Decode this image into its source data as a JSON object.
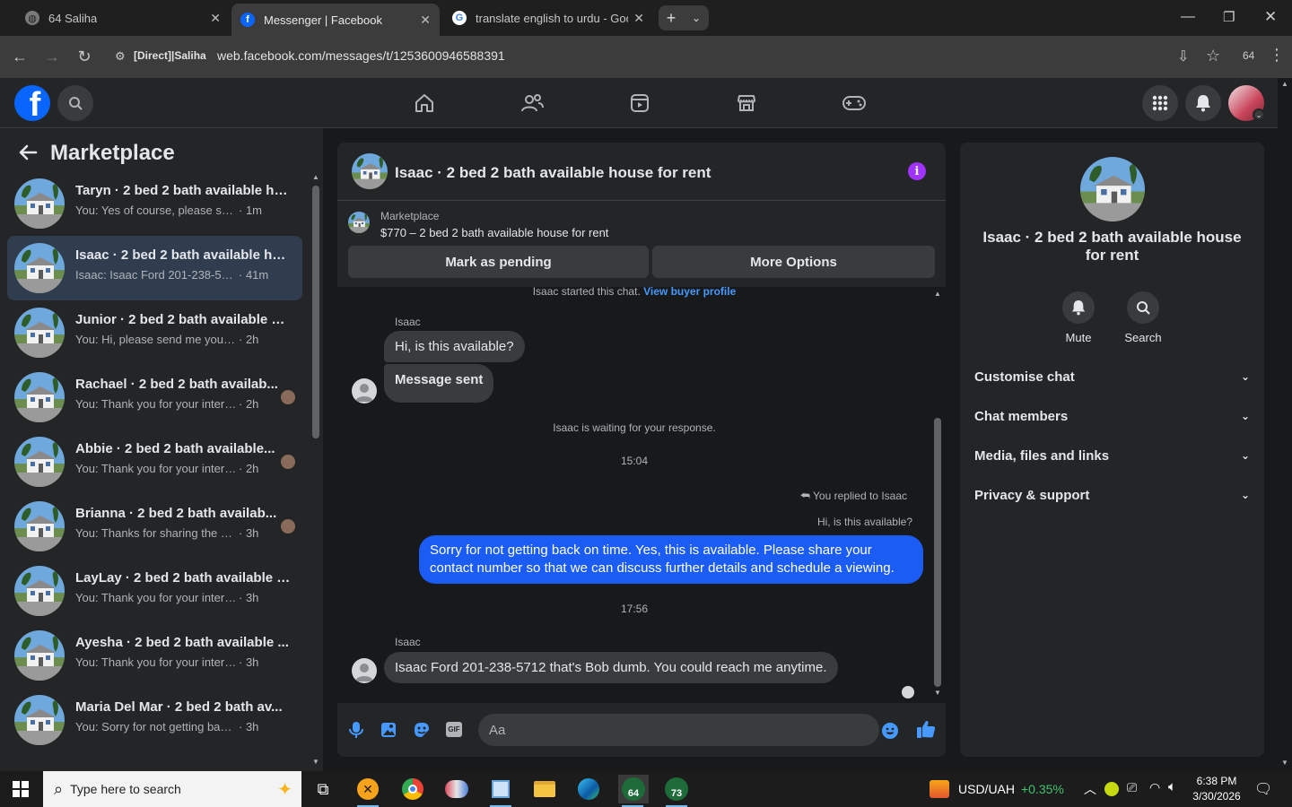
{
  "browser": {
    "tabs": [
      {
        "title": "64 Saliha",
        "active": false
      },
      {
        "title": "Messenger | Facebook",
        "active": true
      },
      {
        "title": "translate english to urdu - Goo",
        "active": false
      }
    ],
    "site_label": "[Direct]|Saliha",
    "url": "web.facebook.com/messages/t/1253600946588391",
    "profile_badge": "64"
  },
  "sidebar": {
    "title": "Marketplace",
    "conversations": [
      {
        "title": "Taryn · 2 bed 2 bath available ho...",
        "preview": "You: Yes of course, please share yo...",
        "time": "· 1m",
        "selected": false,
        "avatar": false
      },
      {
        "title": "Isaac · 2 bed 2 bath available ho...",
        "preview": "Isaac: Isaac Ford 201-238-5712 th...",
        "time": "· 41m",
        "selected": true,
        "avatar": false
      },
      {
        "title": "Junior · 2 bed 2 bath available h...",
        "preview": "You: Hi, please send me your numb...",
        "time": "· 2h",
        "selected": false,
        "avatar": false
      },
      {
        "title": "Rachael · 2 bed 2 bath availab...",
        "preview": "You: Thank you for your interest!...",
        "time": "· 2h",
        "selected": false,
        "avatar": true
      },
      {
        "title": "Abbie · 2 bed 2 bath available...",
        "preview": "You: Thank you for your interest!...",
        "time": "· 2h",
        "selected": false,
        "avatar": true
      },
      {
        "title": "Brianna · 2 bed 2 bath availab...",
        "preview": "You: Thanks for sharing the num...",
        "time": "· 3h",
        "selected": false,
        "avatar": true
      },
      {
        "title": "LayLay · 2 bed 2 bath available h...",
        "preview": "You: Thank you for your interest! Th...",
        "time": "· 3h",
        "selected": false,
        "avatar": false
      },
      {
        "title": "Ayesha · 2 bed 2 bath available ...",
        "preview": "You: Thank you for your interest! Ye...",
        "time": "· 3h",
        "selected": false,
        "avatar": false
      },
      {
        "title": "Maria Del Mar · 2 bed 2 bath av...",
        "preview": "You: Sorry for not getting back on t...",
        "time": "· 3h",
        "selected": false,
        "avatar": false
      }
    ]
  },
  "chat": {
    "title": "Isaac · 2 bed 2 bath available house for rent",
    "listing_source": "Marketplace",
    "listing_desc": "$770 – 2 bed 2 bath available house for rent",
    "mark_pending": "Mark as pending",
    "more_options": "More Options",
    "started_text": "Isaac started this chat.",
    "view_buyer": "View buyer profile",
    "sender_name": "Isaac",
    "msg1": "Hi, is this available?",
    "msg2": "Message sent",
    "waiting": "Isaac is waiting for your response.",
    "time1": "15:04",
    "replied_label": "You replied to Isaac",
    "quoted": "Hi, is this available?",
    "reply": "Sorry for not getting back on time. Yes, this is available. Please share your contact number so that we can discuss further details and schedule a viewing.",
    "time2": "17:56",
    "sender_name2": "Isaac",
    "msg3": "Isaac Ford 201-238-5712 that's Bob dumb. You could reach me anytime.",
    "input_placeholder": "Aa"
  },
  "right_panel": {
    "title": "Isaac · 2 bed 2 bath available house for rent",
    "mute": "Mute",
    "search": "Search",
    "sections": [
      "Customise chat",
      "Chat members",
      "Media, files and links",
      "Privacy & support"
    ]
  },
  "taskbar": {
    "search_placeholder": "Type here to search",
    "ticker": "USD/UAH",
    "ticker_change": "+0.35%",
    "time": "6:38 PM",
    "date": "3/30/2026",
    "badge1": "64",
    "badge2": "73"
  },
  "colors": {
    "accent": "#1b5cf5",
    "brand": "#0866ff",
    "info_icon": "#a033ff"
  }
}
